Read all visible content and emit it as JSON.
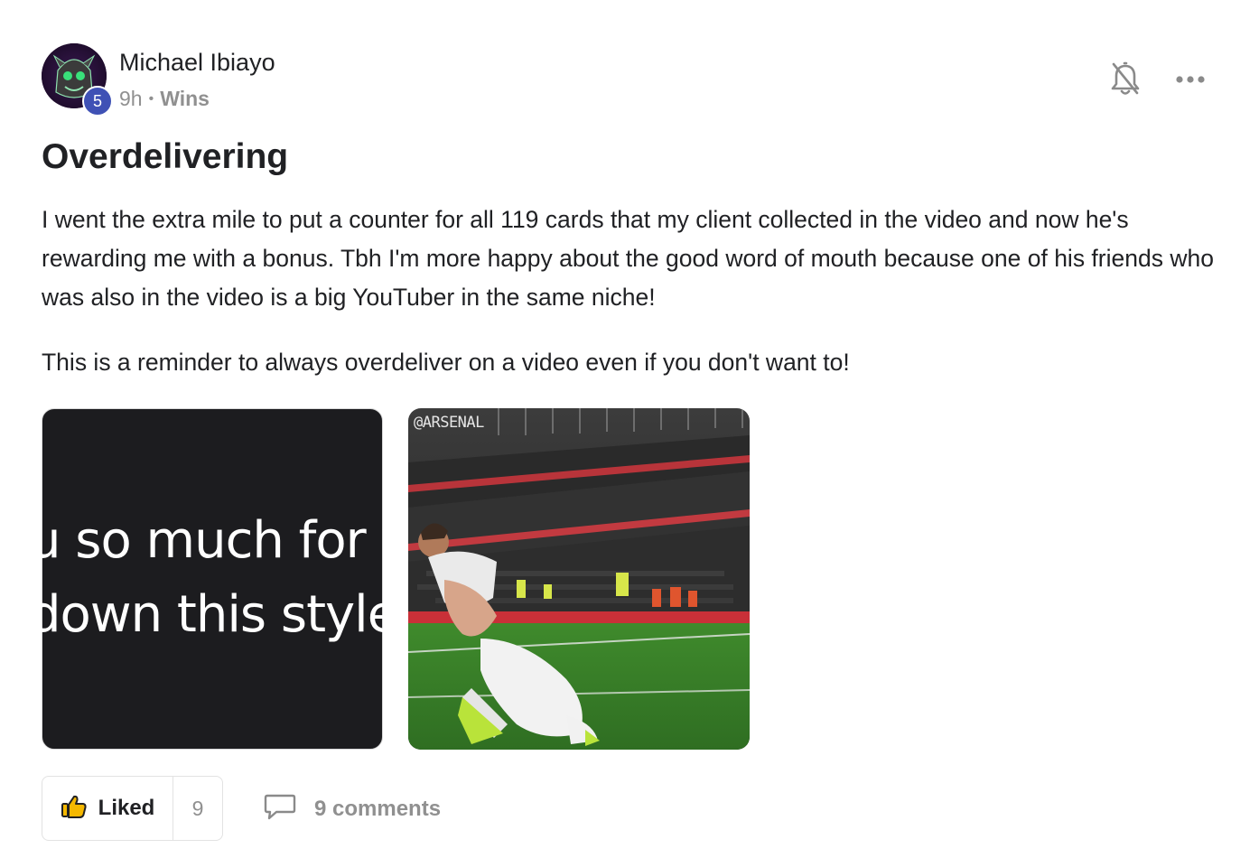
{
  "author": {
    "name": "Michael Ibiayo",
    "level": "5",
    "time_ago": "9h",
    "separator": "•",
    "category": "Wins"
  },
  "post": {
    "title": "Overdelivering",
    "paragraph_1": "I went the extra mile to put a counter for all 119 cards that my client collected in the video and now he's rewarding me with a bonus. Tbh I'm more happy about the good word of mouth because one of his friends who was also in the video is a big YouTuber in the same niche!",
    "paragraph_2": "This is a reminder to always overdeliver on a video even if you don't want to!"
  },
  "attachments": {
    "image_1_text_line_1": "u so much for w",
    "image_1_text_line_2": "down this style",
    "image_2_watermark": "@ARSENAL"
  },
  "actions": {
    "like_label": "Liked",
    "like_count": "9",
    "comments_label": "9 comments"
  },
  "icons": {
    "bell": "bell-muted-icon",
    "more": "more-horizontal-icon",
    "like": "thumbs-up-icon",
    "comment": "comment-bubble-icon"
  },
  "colors": {
    "level_badge": "#3f51b5",
    "like_icon_fill": "#f5b800",
    "muted_text": "#909090"
  }
}
